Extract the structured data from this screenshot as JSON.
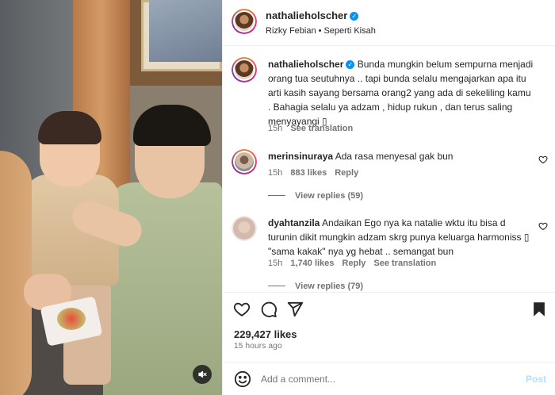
{
  "header": {
    "username": "nathalieholscher",
    "verified": true,
    "audio_artist": "Rizky Febian",
    "audio_separator": "•",
    "audio_track": "Seperti Kisah"
  },
  "caption": {
    "username": "nathalieholscher",
    "text": "Bunda mungkin belum sempurna menjadi orang tua seutuhnya .. tapi bunda selalu mengajarkan apa itu arti kasih sayang bersama orang2 yang ada di sekeliling kamu . Bahagia selalu ya adzam , hidup rukun , dan terus saling menyayangi ",
    "emoji_box": "▯",
    "time": "15h",
    "see_translation": "See translation"
  },
  "comments": [
    {
      "username": "merinsinuraya",
      "text": "Ada rasa menyesal gak bun",
      "time": "15h",
      "likes": "883 likes",
      "reply": "Reply",
      "view_replies": "View replies (59)"
    },
    {
      "username": "dyahtanzila",
      "text": "Andaikan Ego nya ka natalie wktu itu bisa d turunin dikit mungkin adzam skrg punya keluarga harmoniss ",
      "emoji_box": "▯",
      "text_tail": " \"sama kakak\" nya yg hebat .. semangat bun",
      "time": "15h",
      "likes": "1,740 likes",
      "reply": "Reply",
      "see_translation": "See translation",
      "view_replies": "View replies (79)"
    }
  ],
  "likes": "229,427 likes",
  "posted": "15 hours ago",
  "add_comment": {
    "placeholder": "Add a comment...",
    "post_label": "Post"
  },
  "colors": {
    "verified": "#0095f6",
    "secondary_text": "#737373",
    "post_disabled": "#b2dffc"
  },
  "icons": [
    "heart-icon",
    "comment-icon",
    "share-icon",
    "bookmark-icon",
    "emoji-icon",
    "mute-icon"
  ]
}
